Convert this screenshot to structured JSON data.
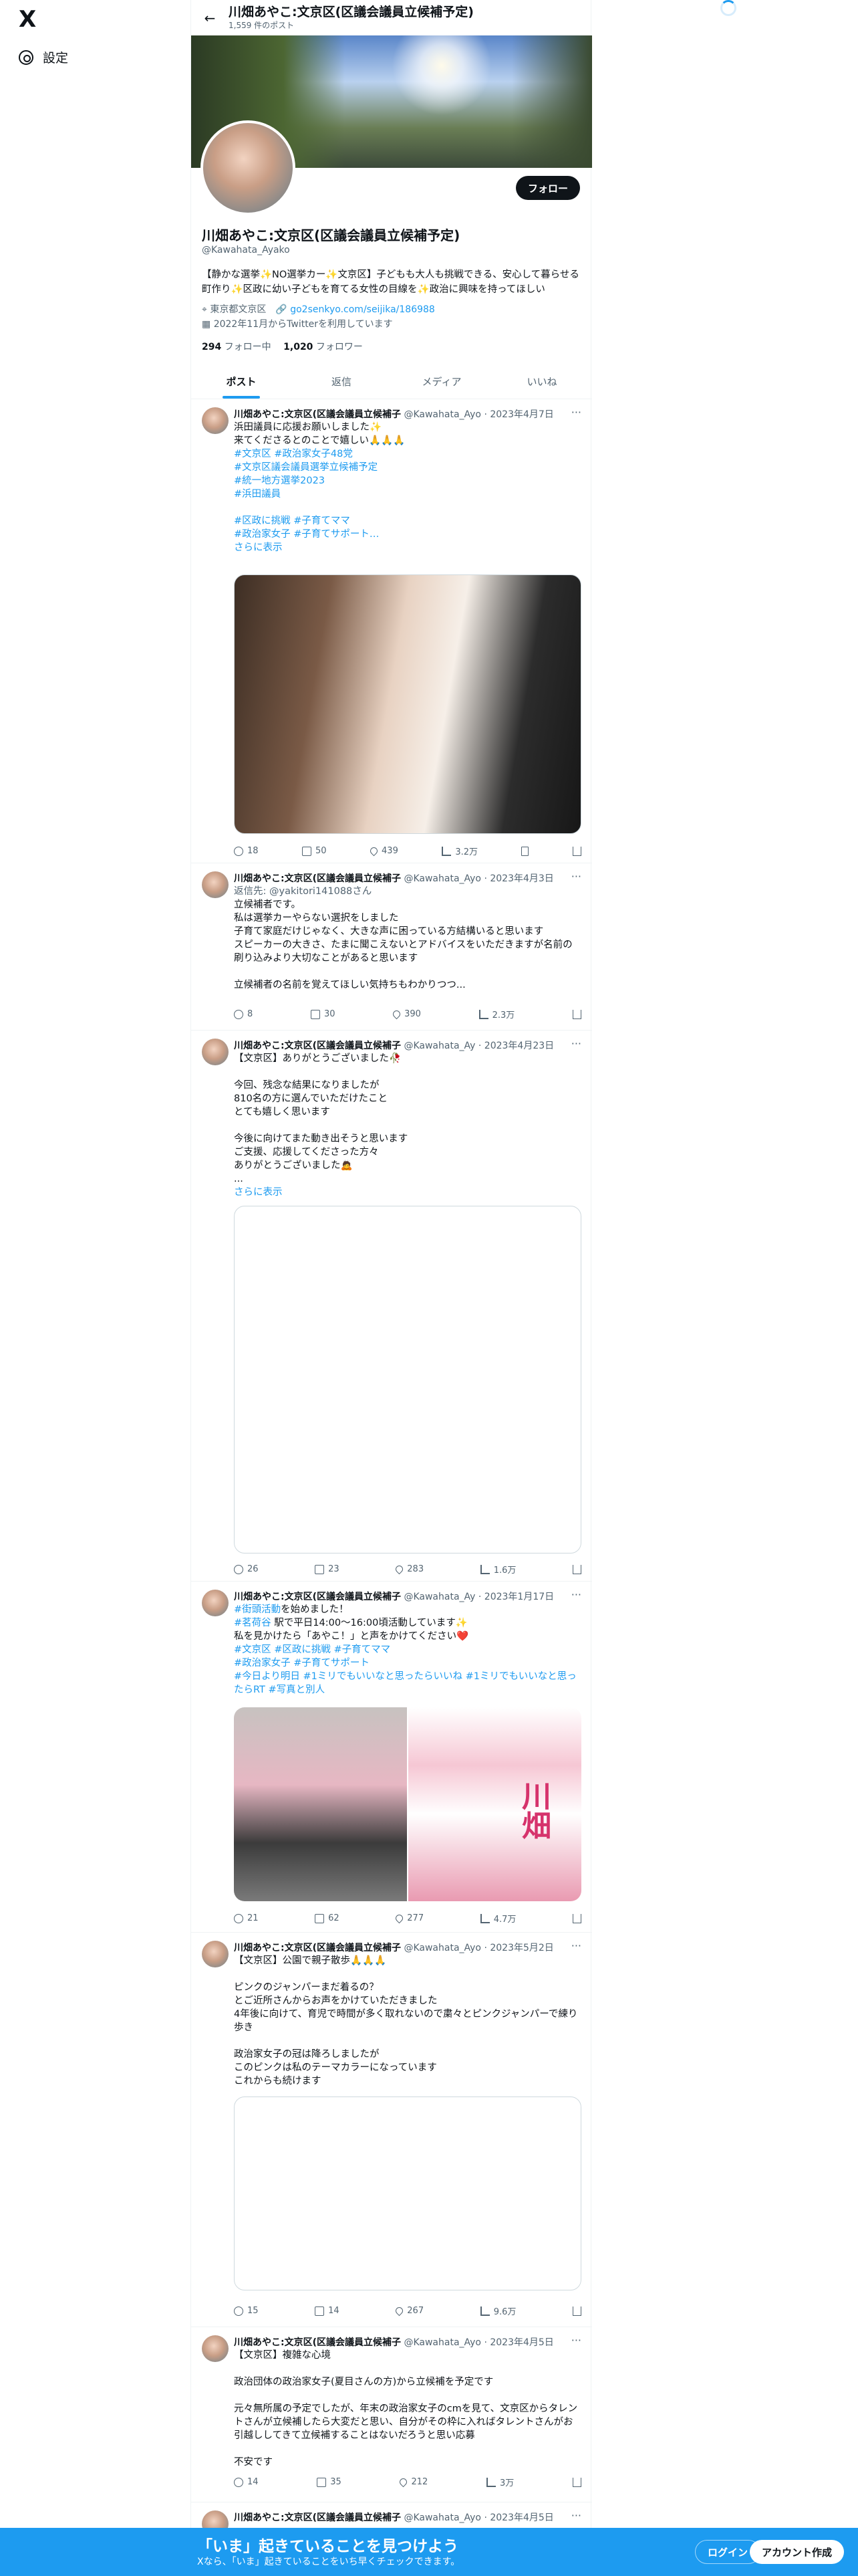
{
  "nav": {
    "logo": "X",
    "settings": "設定"
  },
  "header": {
    "title": "川畑あやこ:文京区(区議会議員立候補予定)",
    "post_count": "1,559 件のポスト"
  },
  "profile": {
    "follow": "フォロー",
    "name": "川畑あやこ:文京区(区議会議員立候補予定)",
    "handle": "@Kawahata_Ayako",
    "bio": "【静かな選挙✨NO選挙カー✨文京区】子どもも大人も挑戦できる、安心して暮らせる町作り✨区政に幼い子どもを育てる女性の目線を✨政治に興味を持ってほしい",
    "location": "東京都文京区",
    "link": "go2senkyo.com/seijika/186988",
    "joined": "2022年11月からTwitterを利用しています",
    "following_num": "294",
    "following_label": "フォロー中",
    "followers_num": "1,020",
    "followers_label": "フォロワー"
  },
  "tabs": [
    "ポスト",
    "返信",
    "メディア",
    "いいね"
  ],
  "posts": [
    {
      "name": "川畑あやこ:文京区(区議会議員立候補子",
      "handle": "@Kawahata_Ayo",
      "date": "2023年4月7日",
      "text": "浜田議員に応援お願いしました✨\n来てくださるとのことで嬉しい🙏🙏🙏",
      "tags": "#文京区 #政治家女子48党\n#文京区議会議員選挙立候補予定\n#統一地方選挙2023\n#浜田議員\n\n#区政に挑戦 #子育てママ\n#政治家女子 #子育てサポート…\nさらに表示",
      "reply": "18",
      "rt": "50",
      "like": "439",
      "view": "3.2万"
    },
    {
      "name": "川畑あやこ:文京区(区議会議員立候補子",
      "handle": "@Kawahata_Ayo",
      "date": "2023年4月3日",
      "replyto": "返信先: @yakitori141088さん",
      "text": "立候補者です。\n私は選挙カーやらない選択をしました\n子育て家庭だけじゃなく、大きな声に困っている方結構いると思います\nスピーカーの大きさ、たまに聞こえないとアドバイスをいただきますが名前の刷り込みより大切なことがあると思います\n\n立候補者の名前を覚えてほしい気持ちもわかりつつ...",
      "reply": "8",
      "rt": "30",
      "like": "390",
      "view": "2.3万"
    },
    {
      "name": "川畑あやこ:文京区(区議会議員立候補子",
      "handle": "@Kawahata_Ay",
      "date": "2023年4月23日",
      "text": "【文京区】ありがとうございました🥀\n\n今回、残念な結果になりましたが\n810名の方に選んでいただけたこと\nとても嬉しく思います\n\n今後に向けてまた動き出そうと思います\nご支援、応援してくださった方々\nありがとうございました🙇\n...",
      "more": "さらに表示",
      "reply": "26",
      "rt": "23",
      "like": "283",
      "view": "1.6万"
    },
    {
      "name": "川畑あやこ:文京区(区議会議員立候補子",
      "handle": "@Kawahata_Ay",
      "date": "2023年1月17日",
      "tags1": "#街頭活動",
      "text": "を始めました！",
      "tags2": "#茗荷谷",
      "text2": "駅で平日14:00〜16:00頃活動しています✨\n私を見かけたら「あやこ！」と声をかけてください❤️",
      "tags3": "#文京区 #区政に挑戦 #子育てママ\n#政治家女子 #子育てサポート\n#今日より明日 #1ミリでもいいなと思ったらいいね #1ミリでもいいなと思ったらRT #写真と別人",
      "poster_name": "川畑",
      "reply": "21",
      "rt": "62",
      "like": "277",
      "view": "4.7万"
    },
    {
      "name": "川畑あやこ:文京区(区議会議員立候補子",
      "handle": "@Kawahata_Ayo",
      "date": "2023年5月2日",
      "text": "【文京区】公園で親子散歩🙏🙏🙏\n\nピンクのジャンパーまだ着るの？\nとご近所さんからお声をかけていただきました\n4年後に向けて、育児で時間が多く取れないので粛々とピンクジャンパーで練り歩き\n\n政治家女子の冠は降ろしましたが\nこのピンクは私のテーマカラーになっています\nこれからも続けます",
      "reply": "15",
      "rt": "14",
      "like": "267",
      "view": "9.6万"
    },
    {
      "name": "川畑あやこ:文京区(区議会議員立候補子",
      "handle": "@Kawahata_Ayo",
      "date": "2023年4月5日",
      "text": "【文京区】複雑な心境\n\n政治団体の政治家女子(夏目さんの方)から立候補を予定です\n\n元々無所属の予定でしたが、年末の政治家女子のcmを見て、文京区からタレントさんが立候補したら大変だと思い、自分がその枠に入ればタレントさんがお引越ししてきて立候補することはないだろうと思い応募\n\n不安です",
      "reply": "14",
      "rt": "35",
      "like": "212",
      "view": "3万"
    },
    {
      "name": "川畑あやこ:文京区(区議会議員立候補子",
      "handle": "@Kawahata_Ayo",
      "date": "2023年4月5日"
    }
  ],
  "bottom": {
    "title": "「いま」起きていることを見つけよう",
    "sub": "Xなら、「いま」起きていることをいち早くチェックできます。",
    "login": "ログイン",
    "signup": "アカウント作成"
  }
}
